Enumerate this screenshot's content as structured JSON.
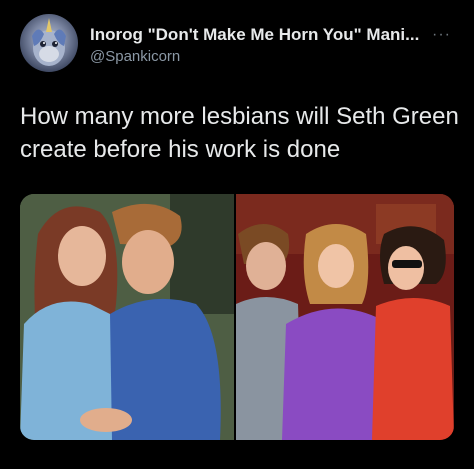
{
  "author": {
    "display_name": "Inorog \"Don't Make Me Horn You\" Mani...",
    "handle": "@Spankicorn"
  },
  "menu": {
    "more_label": "···"
  },
  "tweet": {
    "text": "How many more lesbians will Seth Green create before his work is done"
  },
  "media": {
    "photo_count": 2
  }
}
